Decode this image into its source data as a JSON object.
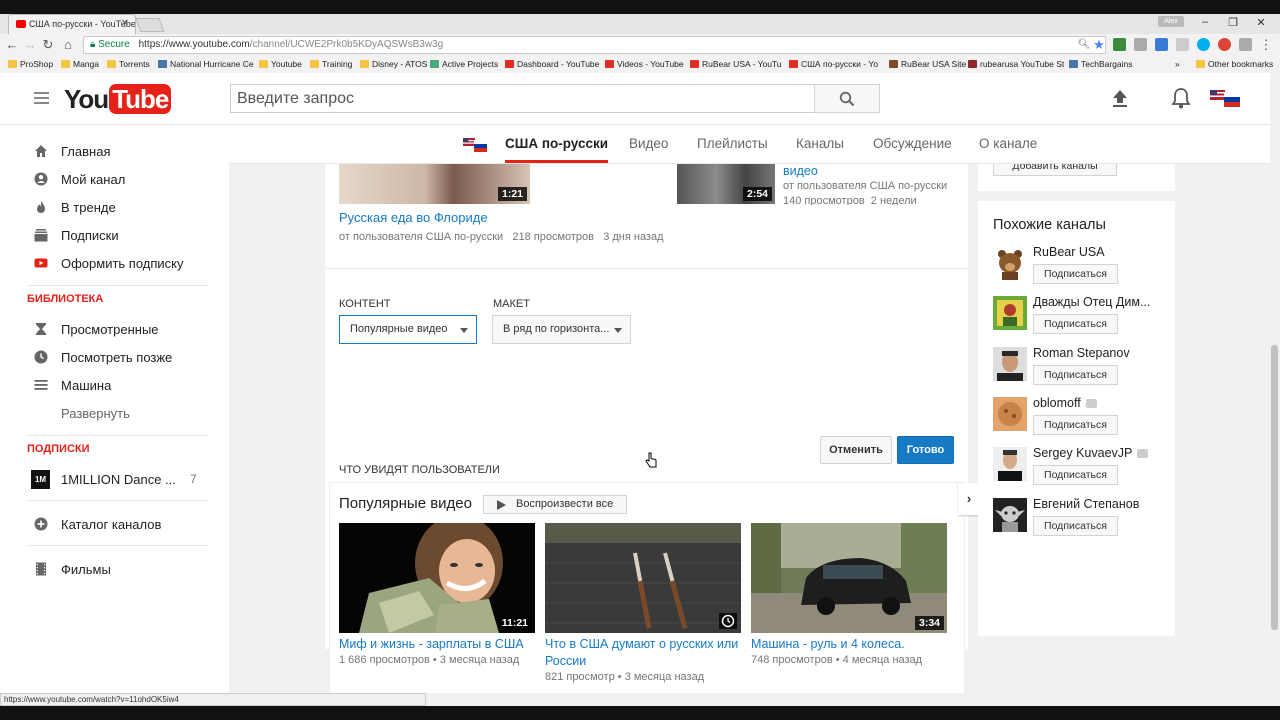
{
  "browser": {
    "tab_title": "США по-русски - YouTube",
    "user_badge": "Alex",
    "secure_label": "Secure",
    "url_host": "https://www.youtube.com",
    "url_path": "/channel/UCWE2Prk0b5KDyAQSWsB3w3g",
    "bookmarks": [
      "ProShop",
      "Manga",
      "Torrents",
      "National Hurricane Ce",
      "Youtube",
      "Training",
      "Disney - ATOS",
      "Active Projects",
      "Dashboard - YouTube",
      "Videos - YouTube",
      "RuBear USA - YouTu",
      "США по-русски - Yo",
      "RuBear USA Site",
      "rubearusa YouTube St",
      "TechBargains"
    ],
    "overflow": "»",
    "other_bookmarks": "Other bookmarks",
    "status_url": "https://www.youtube.com/watch?v=11ohdOK5iw4"
  },
  "masthead": {
    "logo_you": "You",
    "logo_tube": "Tube",
    "search_placeholder": "Введите запрос"
  },
  "guide": {
    "items": [
      "Главная",
      "Мой канал",
      "В тренде",
      "Подписки",
      "Оформить подписку"
    ],
    "library_header": "БИБЛИОТЕКА",
    "library": [
      "Просмотренные",
      "Посмотреть позже",
      "Машина",
      "Развернуть"
    ],
    "subs_header": "ПОДПИСКИ",
    "subscription": {
      "name": "1MILLION Dance ...",
      "count": "7",
      "icon_text": "1M"
    },
    "catalog": "Каталог каналов",
    "films": "Фильмы"
  },
  "channel_nav": {
    "tabs": [
      "США по-русски",
      "Видео",
      "Плейлисты",
      "Каналы",
      "Обсуждение",
      "О канале"
    ]
  },
  "top_videos": [
    {
      "title": "Русская еда во Флориде",
      "by": "от пользователя США по-русски",
      "views": "218 просмотров",
      "age": "3 дня назад",
      "duration": "1:21"
    },
    {
      "title": "видео",
      "by": "от пользователя США по-русски",
      "views": "140 просмотров",
      "age": "2 недели",
      "duration": "2:54"
    }
  ],
  "editor": {
    "content_label": "КОНТЕНТ",
    "content_value": "Популярные видео",
    "layout_label": "МАКЕТ",
    "layout_value": "В ряд по горизонта...",
    "cancel": "Отменить",
    "done": "Готово",
    "preview_label": "ЧТО УВИДЯТ ПОЛЬЗОВАТЕЛИ"
  },
  "shelf": {
    "title": "Популярные видео",
    "play_all": "Воспроизвести все",
    "videos": [
      {
        "title": "Миф и жизнь - зарплаты в США",
        "views": "1 686 просмотров",
        "age": "3 месяца назад",
        "duration": "11:21"
      },
      {
        "title": "Что в США думают о русских или России",
        "views": "821 просмотр",
        "age": "3 месяца назад",
        "duration": ""
      },
      {
        "title": "Машина - руль и 4 колеса.",
        "views": "748 просмотров",
        "age": "4 месяца назад",
        "duration": "3:34"
      }
    ],
    "separator": "•"
  },
  "related": {
    "top_button": "Добавить каналы",
    "header": "Похожие каналы",
    "subscribe": "Подписаться",
    "channels": [
      {
        "name": "RuBear USA",
        "verified": false
      },
      {
        "name": "Дважды Отец Дим...",
        "verified": false
      },
      {
        "name": "Roman Stepanov",
        "verified": false
      },
      {
        "name": "oblomoff",
        "verified": true
      },
      {
        "name": "Sergey KuvaevJP",
        "verified": true
      },
      {
        "name": "Евгений Степанов",
        "verified": false
      }
    ]
  },
  "colors": {
    "accent": "#e62117",
    "link": "#167ac6",
    "primary_button": "#167ac6"
  }
}
